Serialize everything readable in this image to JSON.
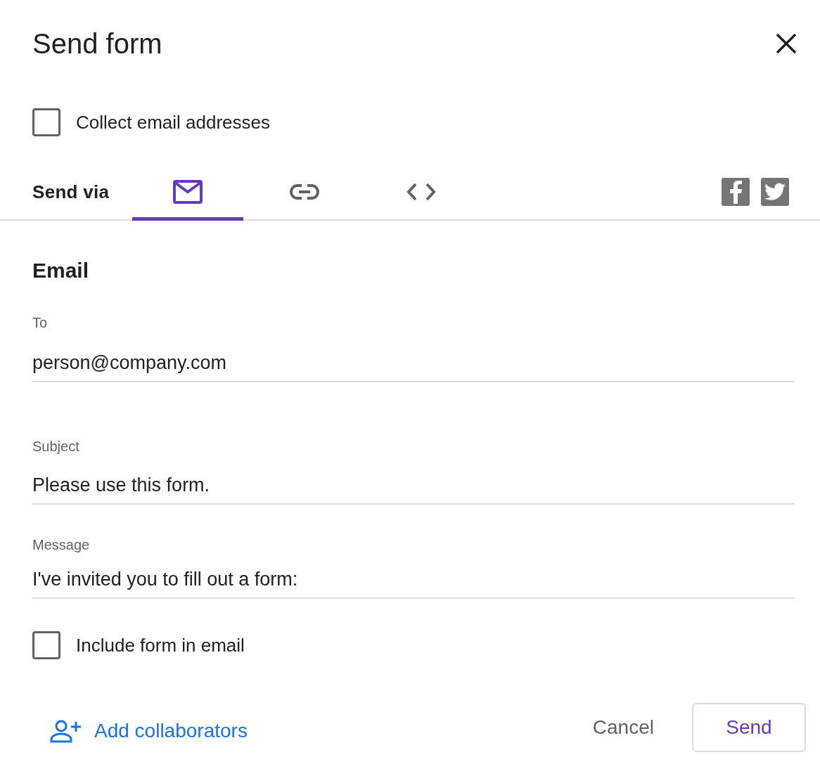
{
  "dialog": {
    "title": "Send form"
  },
  "collect_email": {
    "label": "Collect email addresses",
    "checked": false
  },
  "send_via": {
    "label": "Send via",
    "tabs": [
      {
        "kind": "email",
        "selected": true
      },
      {
        "kind": "link",
        "selected": false
      },
      {
        "kind": "embed",
        "selected": false
      }
    ],
    "share": [
      {
        "kind": "facebook"
      },
      {
        "kind": "twitter"
      }
    ]
  },
  "email": {
    "heading": "Email",
    "fields": [
      {
        "label": "To",
        "value": "person@company.com"
      },
      {
        "label": "Subject",
        "value": "Please use this form."
      },
      {
        "label": "Message",
        "value": "I've invited you to fill out a form:"
      }
    ],
    "include_form": {
      "label": "Include form in email",
      "checked": false
    }
  },
  "footer": {
    "add_collaborators": "Add collaborators",
    "cancel": "Cancel",
    "send": "Send"
  }
}
